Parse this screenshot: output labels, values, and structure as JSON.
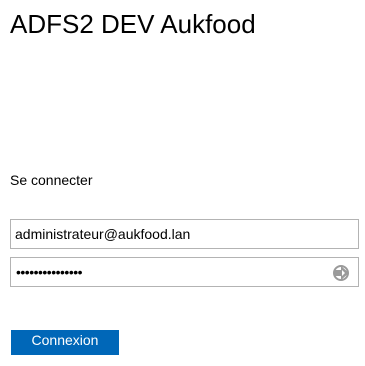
{
  "header": {
    "title": "ADFS2 DEV Aukfood"
  },
  "form": {
    "heading": "Se connecter",
    "username_value": "administrateur@aukfood.lan",
    "password_masked": "•••••••••••••••",
    "password_reveal_icon": "reveal-password-arrow-icon",
    "submit_label": "Connexion"
  },
  "colors": {
    "button_bg": "#0067b8",
    "button_text": "#ffffff",
    "field_border": "#b3b3b3",
    "icon": "#9a9a9a"
  }
}
